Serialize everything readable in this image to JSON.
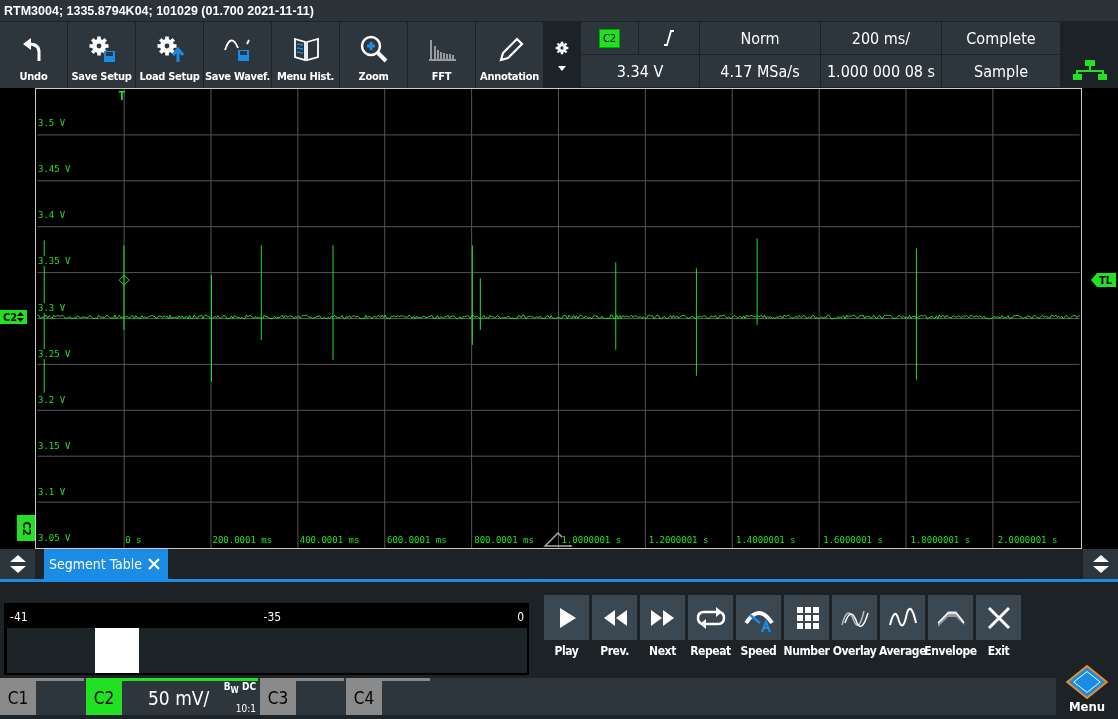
{
  "window": {
    "title": "RTM3004; 1335.8794K04; 101029 (01.700 2021-11-11)"
  },
  "toolbar": [
    {
      "label": "Undo",
      "kind": "undo"
    },
    {
      "label": "Save Setup",
      "kind": "save_setup"
    },
    {
      "label": "Load Setup",
      "kind": "load_setup"
    },
    {
      "label": "Save Wavef.",
      "kind": "save_wave"
    },
    {
      "label": "Menu Hist.",
      "kind": "history"
    },
    {
      "label": "Zoom",
      "kind": "zoom"
    },
    {
      "label": "FFT",
      "kind": "fft"
    },
    {
      "label": "Annotation",
      "kind": "annotation"
    }
  ],
  "acquisition": {
    "trigger_source": "C2",
    "trigger_level": "3.34 V",
    "trigger_mode": "Norm",
    "sample_rate": "4.17 MSa/s",
    "time_scale": "200 ms/",
    "time_position": "1.000 000 08 s",
    "state": "Complete",
    "mode": "Sample"
  },
  "plot": {
    "y_labels": [
      "3.5 V",
      "3.45 V",
      "3.4 V",
      "3.35 V",
      "3.3 V",
      "3.25 V",
      "3.2 V",
      "3.15 V",
      "3.1 V",
      "3.05 V"
    ],
    "x_labels": [
      "0 s",
      "200.0001 ms",
      "400.0001 ms",
      "600.0001 ms",
      "800.0001 ms",
      "1.0000001 s",
      "1.2000001 s",
      "1.4000001 s",
      "1.6000001 s",
      "1.8000001 s",
      "2.0000001 s"
    ],
    "trigger_marker": "T",
    "trigger_level_marker": "TL",
    "channel_marker": "C2",
    "channel_ground_marker": "C2"
  },
  "segment_tab": {
    "label": "Segment Table",
    "selected": true
  },
  "segment_slider": {
    "min": "-41",
    "current": "-35",
    "max": "0",
    "level": 0.17
  },
  "playback_buttons": [
    {
      "label": "Play",
      "kind": "play"
    },
    {
      "label": "Prev.",
      "kind": "prev"
    },
    {
      "label": "Next",
      "kind": "next"
    },
    {
      "label": "Repeat",
      "kind": "repeat"
    },
    {
      "label": "Speed",
      "kind": "speed"
    },
    {
      "label": "Number",
      "kind": "number"
    },
    {
      "label": "Overlay",
      "kind": "overlay"
    },
    {
      "label": "Average",
      "kind": "average"
    },
    {
      "label": "Envelope",
      "kind": "envelope"
    },
    {
      "label": "Exit",
      "kind": "exit"
    }
  ],
  "channels": [
    {
      "label": "C1",
      "selected": false
    },
    {
      "label": "C2",
      "selected": true,
      "scale": "50 mV/",
      "bandwidth": "B$_{W}$ DC",
      "probe": "10:1"
    },
    {
      "label": "C3",
      "selected": false
    },
    {
      "label": "C4",
      "selected": false
    }
  ],
  "menu": {
    "label": "Menu"
  }
}
